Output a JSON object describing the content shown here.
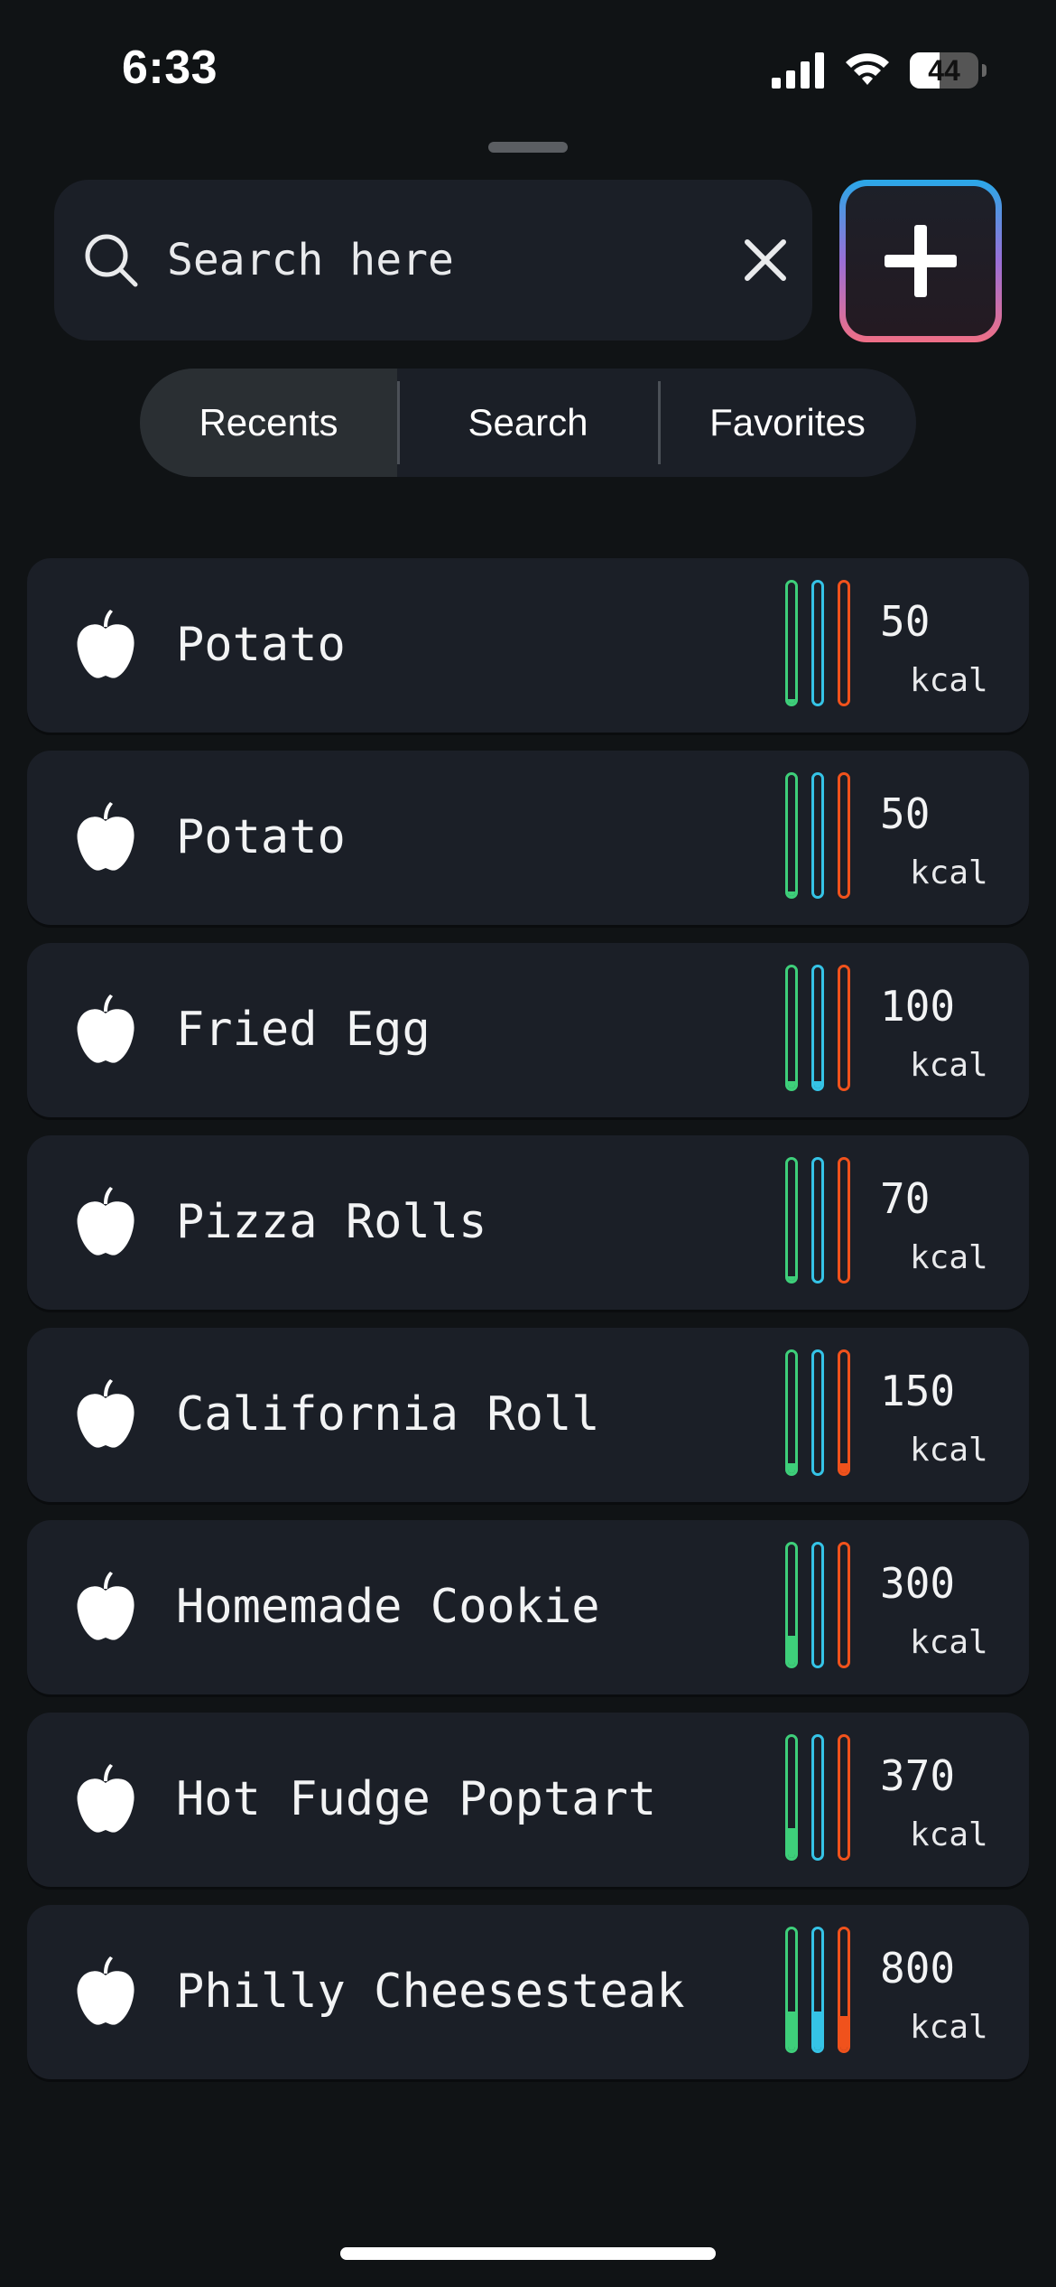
{
  "status_bar": {
    "time": "6:33",
    "battery_level": "44"
  },
  "search": {
    "placeholder": "Search here"
  },
  "tabs": [
    {
      "label": "Recents",
      "selected": true
    },
    {
      "label": "Search",
      "selected": false
    },
    {
      "label": "Favorites",
      "selected": false
    }
  ],
  "foods": [
    {
      "name": "Potato",
      "kcal": "50",
      "unit": "kcal",
      "macro_levels": [
        0.04,
        0.0,
        0.0
      ]
    },
    {
      "name": "Potato",
      "kcal": "50",
      "unit": "kcal",
      "macro_levels": [
        0.04,
        0.0,
        0.0
      ]
    },
    {
      "name": "Fried Egg",
      "kcal": "100",
      "unit": "kcal",
      "macro_levels": [
        0.06,
        0.06,
        0.0
      ]
    },
    {
      "name": "Pizza Rolls",
      "kcal": "70",
      "unit": "kcal",
      "macro_levels": [
        0.04,
        0.0,
        0.0
      ]
    },
    {
      "name": "California Roll",
      "kcal": "150",
      "unit": "kcal",
      "macro_levels": [
        0.08,
        0.0,
        0.08
      ]
    },
    {
      "name": "Homemade Cookie",
      "kcal": "300",
      "unit": "kcal",
      "macro_levels": [
        0.25,
        0.0,
        0.0
      ]
    },
    {
      "name": "Hot Fudge Poptart",
      "kcal": "370",
      "unit": "kcal",
      "macro_levels": [
        0.25,
        0.0,
        0.0
      ]
    },
    {
      "name": "Philly Cheesesteak",
      "kcal": "800",
      "unit": "kcal",
      "macro_levels": [
        0.32,
        0.32,
        0.28
      ]
    }
  ],
  "colors": {
    "background": "#101315",
    "card": "#1b1f27",
    "bar_1": "#3ecf7a",
    "bar_2": "#35c3e6",
    "bar_3": "#f0521c",
    "add_gradient_top": "#2aa8e8",
    "add_gradient_bottom": "#ef6f86"
  },
  "icons": {
    "search": "search-icon",
    "clear": "close-icon",
    "add": "plus-icon",
    "food": "apple-icon"
  }
}
